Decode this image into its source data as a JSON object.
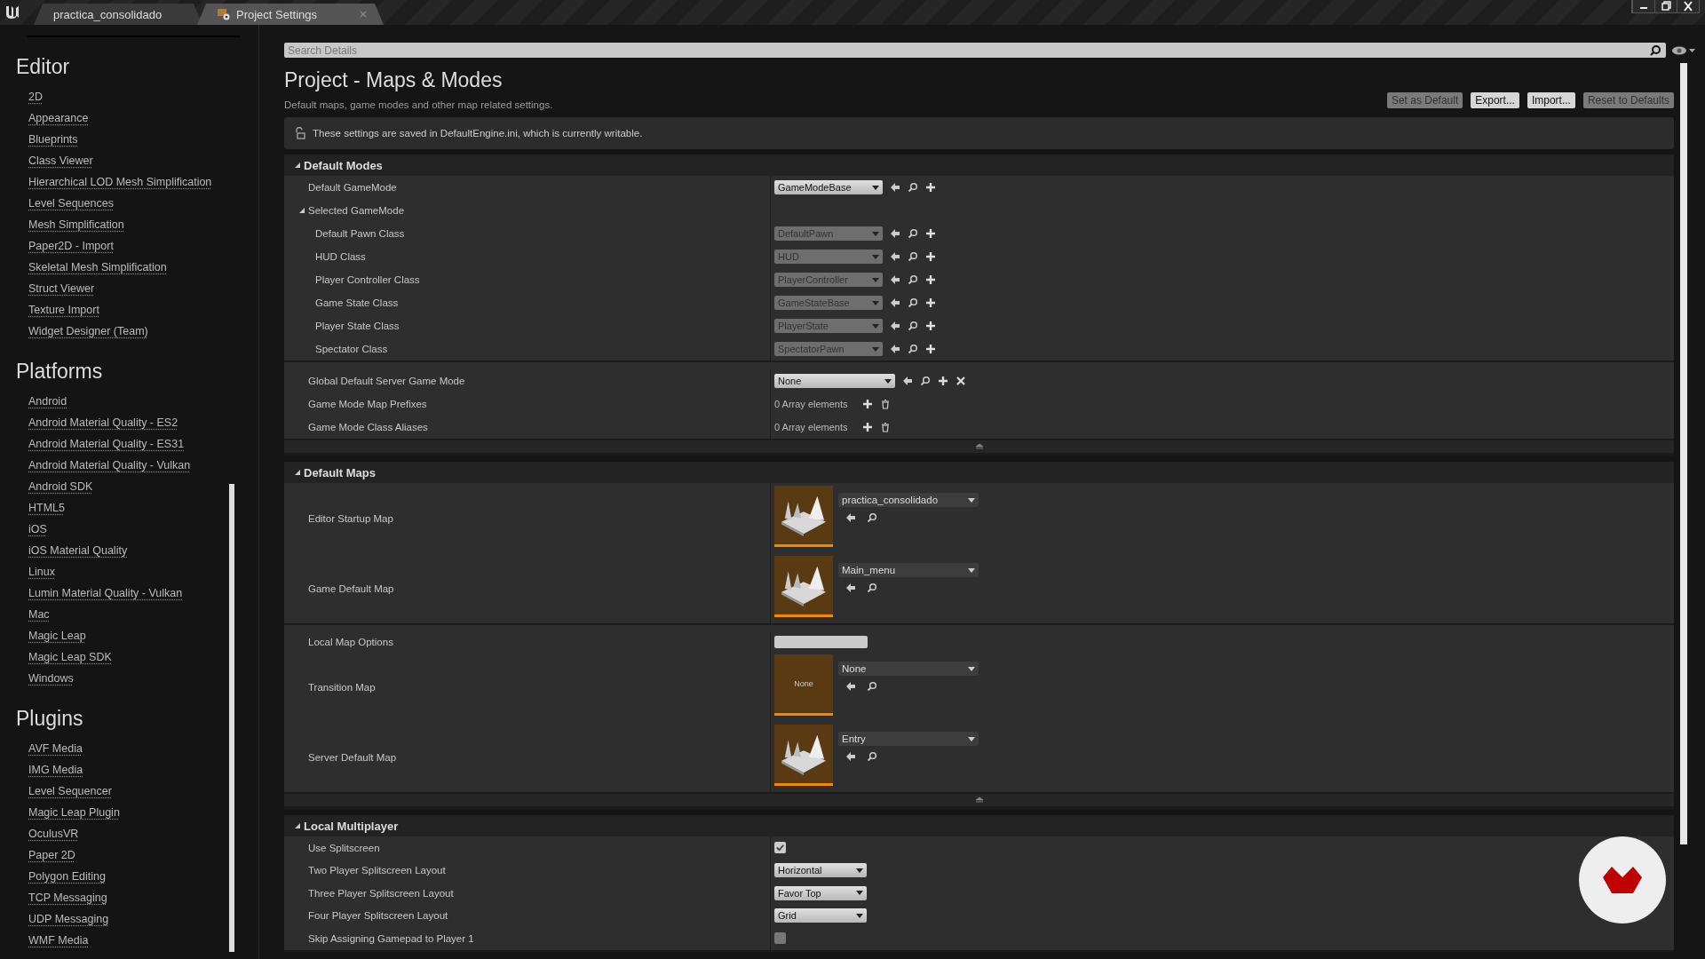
{
  "tabs": [
    {
      "label": "practica_consolidado",
      "selected": false
    },
    {
      "label": "Project Settings",
      "selected": true
    }
  ],
  "sidebar": {
    "groups": [
      {
        "title": "Editor",
        "items": [
          "2D",
          "Appearance",
          "Blueprints",
          "Class Viewer",
          "Hierarchical LOD Mesh Simplification",
          "Level Sequences",
          "Mesh Simplification",
          "Paper2D - Import",
          "Skeletal Mesh Simplification",
          "Struct Viewer",
          "Texture Import",
          "Widget Designer (Team)"
        ]
      },
      {
        "title": "Platforms",
        "items": [
          "Android",
          "Android Material Quality - ES2",
          "Android Material Quality - ES31",
          "Android Material Quality - Vulkan",
          "Android SDK",
          "HTML5",
          "iOS",
          "iOS Material Quality",
          "Linux",
          "Lumin Material Quality - Vulkan",
          "Mac",
          "Magic Leap",
          "Magic Leap SDK",
          "Windows"
        ]
      },
      {
        "title": "Plugins",
        "items": [
          "AVF Media",
          "IMG Media",
          "Level Sequencer",
          "Magic Leap Plugin",
          "OculusVR",
          "Paper 2D",
          "Polygon Editing",
          "TCP Messaging",
          "UDP Messaging",
          "WMF Media"
        ]
      }
    ]
  },
  "search": {
    "placeholder": "Search Details"
  },
  "page": {
    "title": "Project - Maps & Modes",
    "subtitle": "Default maps, game modes and other map related settings.",
    "buttons": [
      {
        "label": "Set as Default",
        "disabled": true
      },
      {
        "label": "Export...",
        "disabled": false
      },
      {
        "label": "Import...",
        "disabled": false
      },
      {
        "label": "Reset to Defaults",
        "disabled": true
      }
    ],
    "notice": "These settings are saved in DefaultEngine.ini, which is currently writable."
  },
  "sections": [
    {
      "title": "Default Modes",
      "expanded": true,
      "groups": [
        [
          {
            "kind": "class",
            "label": "Default GameMode",
            "value": "GameModeBase",
            "disabled": false
          },
          {
            "kind": "group",
            "label": "Selected GameMode",
            "expanded": true,
            "children": [
              {
                "kind": "class",
                "label": "Default Pawn Class",
                "value": "DefaultPawn",
                "disabled": true
              },
              {
                "kind": "class",
                "label": "HUD Class",
                "value": "HUD",
                "disabled": true
              },
              {
                "kind": "class",
                "label": "Player Controller Class",
                "value": "PlayerController",
                "disabled": true
              },
              {
                "kind": "class",
                "label": "Game State Class",
                "value": "GameStateBase",
                "disabled": true
              },
              {
                "kind": "class",
                "label": "Player State Class",
                "value": "PlayerState",
                "disabled": true
              },
              {
                "kind": "class",
                "label": "Spectator Class",
                "value": "SpectatorPawn",
                "disabled": true
              }
            ]
          }
        ],
        [
          {
            "kind": "class_clear",
            "label": "Global Default Server Game Mode",
            "value": "None",
            "disabled": false
          },
          {
            "kind": "array",
            "label": "Game Mode Map Prefixes",
            "value": "0 Array elements"
          },
          {
            "kind": "array",
            "label": "Game Mode Class Aliases",
            "value": "0 Array elements"
          }
        ]
      ]
    },
    {
      "title": "Default Maps",
      "expanded": true,
      "groups": [
        [
          {
            "kind": "map",
            "label": "Editor Startup Map",
            "value": "practica_consolidado"
          },
          {
            "kind": "map",
            "label": "Game Default Map",
            "value": "Main_menu"
          }
        ],
        [
          {
            "kind": "text",
            "label": "Local Map Options"
          },
          {
            "kind": "map_empty",
            "label": "Transition Map",
            "value": "None",
            "thumb": "None"
          },
          {
            "kind": "map",
            "label": "Server Default Map",
            "value": "Entry"
          }
        ]
      ]
    },
    {
      "title": "Local Multiplayer",
      "expanded": true,
      "groups": [
        [
          {
            "kind": "checkbox",
            "label": "Use Splitscreen",
            "checked": true
          },
          {
            "kind": "enum",
            "label": "Two Player Splitscreen Layout",
            "value": "Horizontal"
          },
          {
            "kind": "enum",
            "label": "Three Player Splitscreen Layout",
            "value": "Favor Top"
          },
          {
            "kind": "enum",
            "label": "Four Player Splitscreen Layout",
            "value": "Grid"
          },
          {
            "kind": "checkbox",
            "label": "Skip Assigning Gamepad to Player 1",
            "checked": false
          }
        ]
      ]
    }
  ]
}
